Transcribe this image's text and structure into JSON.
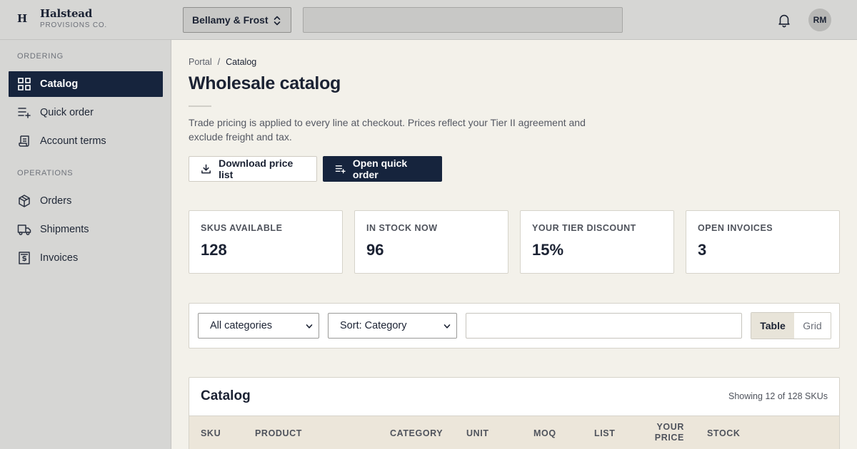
{
  "brand": {
    "mark": "H",
    "name": "Halstead",
    "sub": "PROVISIONS CO."
  },
  "topbar": {
    "org": "Bellamy & Frost",
    "avatar_initials": "RM"
  },
  "sidebar": {
    "sections": [
      {
        "title": "ORDERING",
        "items": [
          {
            "label": "Catalog",
            "icon": "grid-icon",
            "active": true
          },
          {
            "label": "Quick order",
            "icon": "list-plus-icon"
          },
          {
            "label": "Account terms",
            "icon": "scroll-icon"
          }
        ]
      },
      {
        "title": "OPERATIONS",
        "items": [
          {
            "label": "Orders",
            "icon": "box-icon"
          },
          {
            "label": "Shipments",
            "icon": "truck-icon"
          },
          {
            "label": "Invoices",
            "icon": "invoice-icon"
          }
        ]
      }
    ]
  },
  "breadcrumb": {
    "root": "Portal",
    "separator": "/",
    "current": "Catalog"
  },
  "page": {
    "title": "Wholesale catalog",
    "intro": "Trade pricing is applied to every line at checkout. Prices reflect your Tier II agreement and exclude freight and tax."
  },
  "actions": {
    "download": "Download price list",
    "quick_order": "Open quick order"
  },
  "stats": [
    {
      "label": "SKUS AVAILABLE",
      "value": "128"
    },
    {
      "label": "IN STOCK NOW",
      "value": "96"
    },
    {
      "label": "YOUR TIER DISCOUNT",
      "value": "15%"
    },
    {
      "label": "OPEN INVOICES",
      "value": "3"
    }
  ],
  "filters": {
    "category": "All categories",
    "sort": "Sort: Category",
    "view_table": "Table",
    "view_grid": "Grid"
  },
  "catalog": {
    "title": "Catalog",
    "showing": "Showing 12 of 128 SKUs",
    "columns": [
      "SKU",
      "PRODUCT",
      "CATEGORY",
      "UNIT",
      "MOQ",
      "LIST",
      "YOUR PRICE",
      "STOCK"
    ]
  },
  "colors": {
    "navy": "#16243d",
    "bg": "#f3f1ea",
    "chrome": "#d6d6d4"
  }
}
